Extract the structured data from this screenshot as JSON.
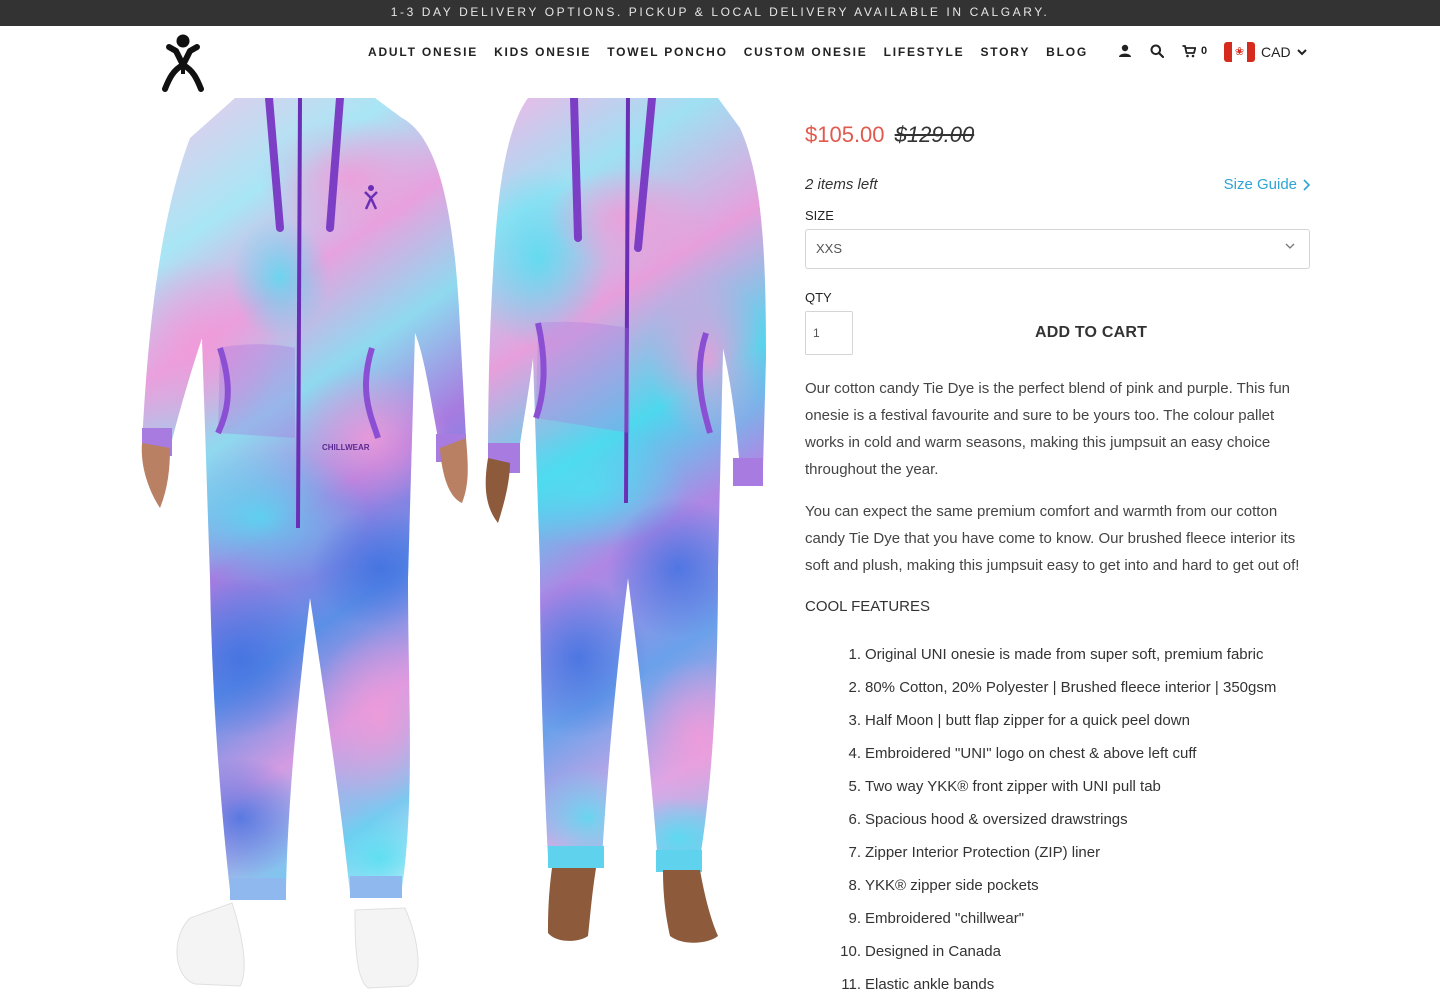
{
  "announcement": "1-3 day delivery options. Pickup & local delivery available in Calgary.",
  "nav": {
    "items": [
      "ADULT ONESIE",
      "KIDS ONESIE",
      "TOWEL PONCHO",
      "CUSTOM ONESIE",
      "LIFESTYLE",
      "STORY",
      "BLOG"
    ],
    "cart_count": "0",
    "currency": "CAD",
    "icons": [
      "account-icon",
      "search-icon",
      "cart-icon",
      "chevron-down-icon"
    ]
  },
  "product": {
    "price": "$105.00",
    "compare_price": "$129.00",
    "stock": "2 items left",
    "size_guide": "Size Guide",
    "size_label": "SIZE",
    "size_selected": "XXS",
    "qty_label": "QTY",
    "qty_value": "1",
    "add_to_cart": "ADD TO CART",
    "desc_1": "Our cotton candy Tie Dye is the perfect blend of pink and purple. This fun onesie is a festival favourite and sure to be yours too. The colour pallet works in cold and warm seasons, making this jumpsuit an easy choice throughout the year.",
    "desc_2": "You can expect the same premium comfort and warmth from our cotton candy Tie Dye that you have come to know. Our brushed fleece interior its soft and plush, making this jumpsuit easy to get into and hard to get out of!",
    "features_title": "COOL FEATURES",
    "features": [
      "Original UNI onesie is made from super soft, premium fabric",
      "80% Cotton, 20% Polyester | Brushed fleece interior | 350gsm",
      "Half Moon | butt flap zipper for a quick peel down",
      "Embroidered \"UNI\" logo on chest & above left cuff",
      "Two way YKK® front zipper with UNI pull tab",
      "Spacious hood & oversized drawstrings",
      "Zipper Interior Protection (ZIP) liner",
      "YKK® zipper side pockets",
      "Embroidered \"chillwear\"",
      "Designed in Canada",
      "Elastic ankle bands"
    ],
    "feature_numbers": [
      "1.",
      "2.",
      "3.",
      "4.",
      "5.",
      "6.",
      "7.",
      "8.",
      "9.",
      "10.",
      "11."
    ],
    "pocket_label": "CHILLWEAR"
  },
  "colors": {
    "sale": "#e05a4e",
    "link": "#2ea3d6",
    "topbar": "#333333",
    "tie_dye": [
      "#f3c6ea",
      "#63d6ef",
      "#8a5fd6",
      "#3f6fe0",
      "#c48ae6"
    ]
  }
}
